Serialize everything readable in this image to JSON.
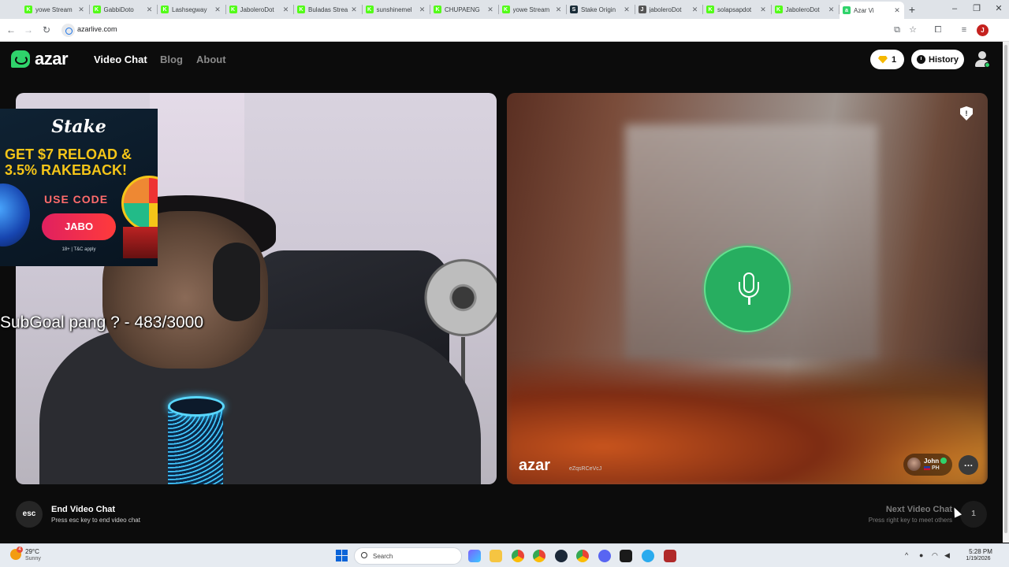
{
  "browser": {
    "tabs": [
      {
        "title": "yowe Stream",
        "fav_color": "#53fc18",
        "fav_glyph": "K"
      },
      {
        "title": "GabbiDoto",
        "fav_color": "#53fc18",
        "fav_glyph": "K"
      },
      {
        "title": "Lashsegway",
        "fav_color": "#53fc18",
        "fav_glyph": "K"
      },
      {
        "title": "JaboleroDot",
        "fav_color": "#53fc18",
        "fav_glyph": "K"
      },
      {
        "title": "Buladas Strea",
        "fav_color": "#53fc18",
        "fav_glyph": "K"
      },
      {
        "title": "sunshinemel",
        "fav_color": "#53fc18",
        "fav_glyph": "K"
      },
      {
        "title": "CHUPAENG",
        "fav_color": "#53fc18",
        "fav_glyph": "K"
      },
      {
        "title": "yowe Stream",
        "fav_color": "#53fc18",
        "fav_glyph": "K"
      },
      {
        "title": "Stake Origin",
        "fav_color": "#1a2c38",
        "fav_glyph": "S"
      },
      {
        "title": "jaboleroDot",
        "fav_color": "#555555",
        "fav_glyph": "J"
      },
      {
        "title": "solapsapdot",
        "fav_color": "#53fc18",
        "fav_glyph": "K"
      },
      {
        "title": "JaboleroDot",
        "fav_color": "#53fc18",
        "fav_glyph": "K"
      },
      {
        "title": "Azar Vi",
        "fav_color": "#2fd36b",
        "fav_glyph": "a",
        "active": true
      }
    ],
    "url": "azarlive.com",
    "profile_initial": "J"
  },
  "site": {
    "logo_text": "azar",
    "nav": [
      {
        "label": "Video Chat",
        "active": true
      },
      {
        "label": "Blog",
        "active": false
      },
      {
        "label": "About",
        "active": false
      }
    ],
    "gems_count": "1",
    "history_label": "History"
  },
  "remote": {
    "watermark": "azar",
    "watermark_code": "eZqsRCeVcJ",
    "peer_name": "John",
    "peer_country": "PH"
  },
  "controls": {
    "end_key": "esc",
    "end_title": "End Video Chat",
    "end_hint": "Press esc key to end video chat",
    "next_title": "Next Video Chat",
    "next_hint": "Press right key to meet others",
    "next_key": "1"
  },
  "overlay": {
    "ad_brand": "Stake",
    "ad_line1": "GET $7 RELOAD &",
    "ad_line2": "3.5% RAKEBACK!",
    "ad_use_code": "USE CODE",
    "ad_code": "JABO",
    "ad_terms": "18+ | T&C apply",
    "subgoal": "SubGoal pang ? - 483/3000"
  },
  "taskbar": {
    "weather_temp": "29°C",
    "weather_cond": "Sunny",
    "weather_badge": "4",
    "search_label": "Search",
    "time": "5:28 PM",
    "date": "1/19/2026"
  },
  "colors": {
    "brand_green": "#2fd36b",
    "mic_green": "#27ae60",
    "page_bg": "#0c0c0c"
  }
}
